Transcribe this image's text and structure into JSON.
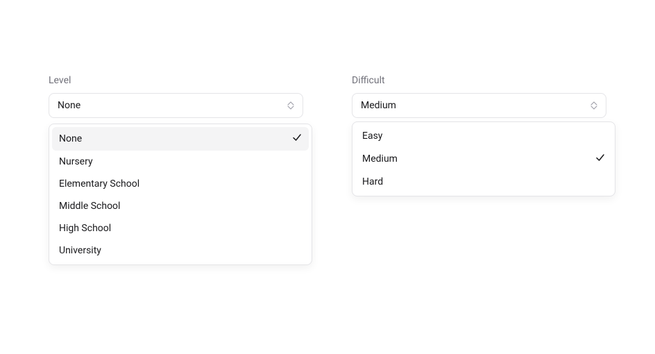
{
  "level": {
    "label": "Level",
    "selected": "None",
    "options": [
      "None",
      "Nursery",
      "Elementary School",
      "Middle School",
      "High School",
      "University"
    ],
    "highlightedIndex": 0,
    "checkedIndex": 0
  },
  "difficult": {
    "label": "Difficult",
    "selected": "Medium",
    "options": [
      "Easy",
      "Medium",
      "Hard"
    ],
    "highlightedIndex": -1,
    "checkedIndex": 1
  }
}
